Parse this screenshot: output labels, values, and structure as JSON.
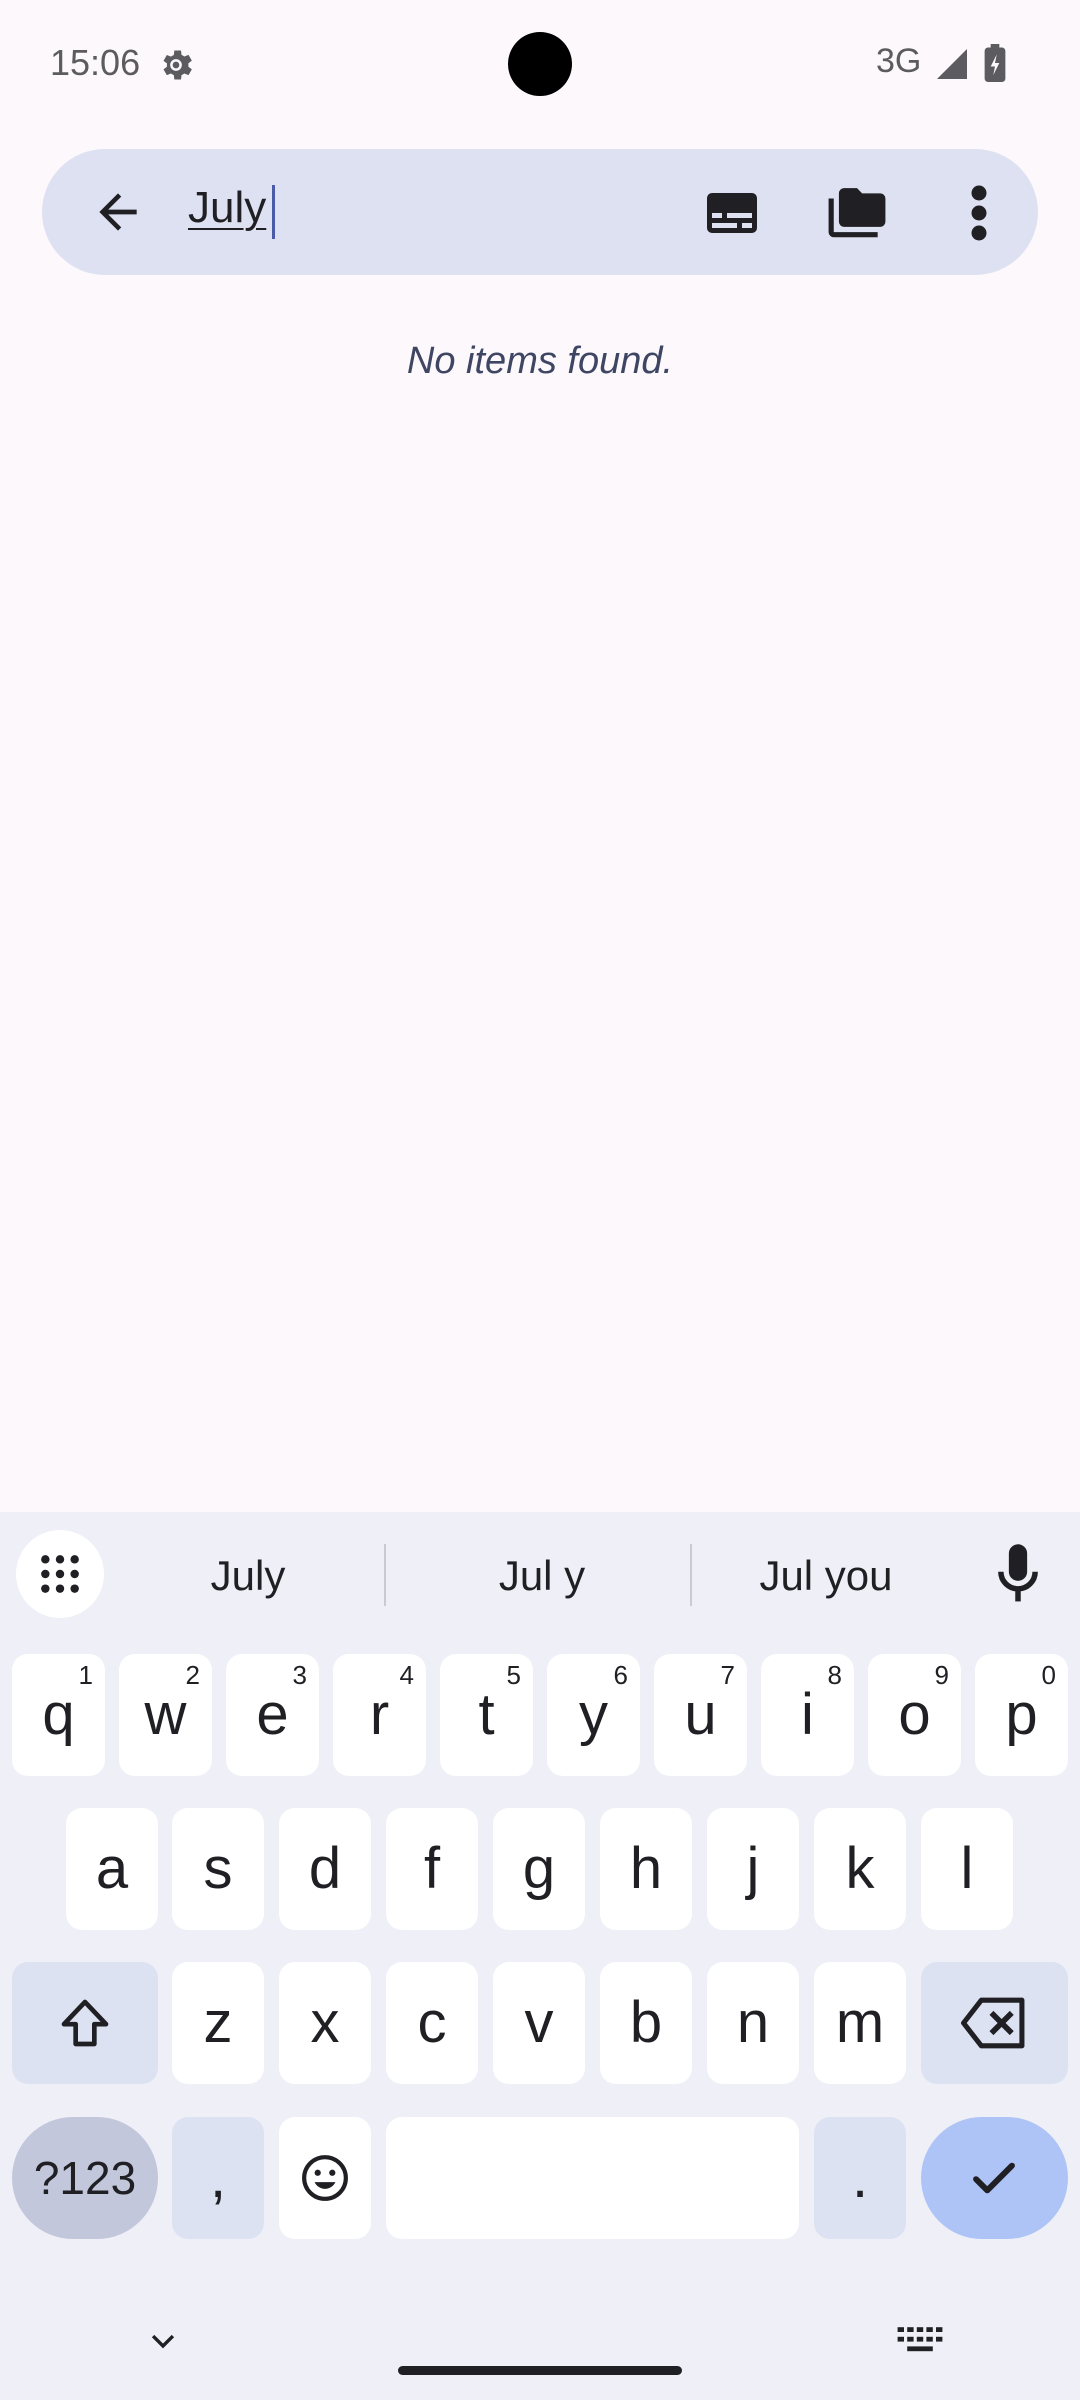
{
  "status_bar": {
    "time": "15:06",
    "network": "3G"
  },
  "search": {
    "query": "July"
  },
  "results": {
    "empty_message": "No items found."
  },
  "keyboard": {
    "suggestions": [
      "July",
      "Jul y",
      "Jul you"
    ],
    "row1": [
      {
        "key": "q",
        "hint": "1"
      },
      {
        "key": "w",
        "hint": "2"
      },
      {
        "key": "e",
        "hint": "3"
      },
      {
        "key": "r",
        "hint": "4"
      },
      {
        "key": "t",
        "hint": "5"
      },
      {
        "key": "y",
        "hint": "6"
      },
      {
        "key": "u",
        "hint": "7"
      },
      {
        "key": "i",
        "hint": "8"
      },
      {
        "key": "o",
        "hint": "9"
      },
      {
        "key": "p",
        "hint": "0"
      }
    ],
    "row2": [
      "a",
      "s",
      "d",
      "f",
      "g",
      "h",
      "j",
      "k",
      "l"
    ],
    "row3": [
      "z",
      "x",
      "c",
      "v",
      "b",
      "n",
      "m"
    ],
    "symbols_label": "?123",
    "comma": ",",
    "period": "."
  }
}
